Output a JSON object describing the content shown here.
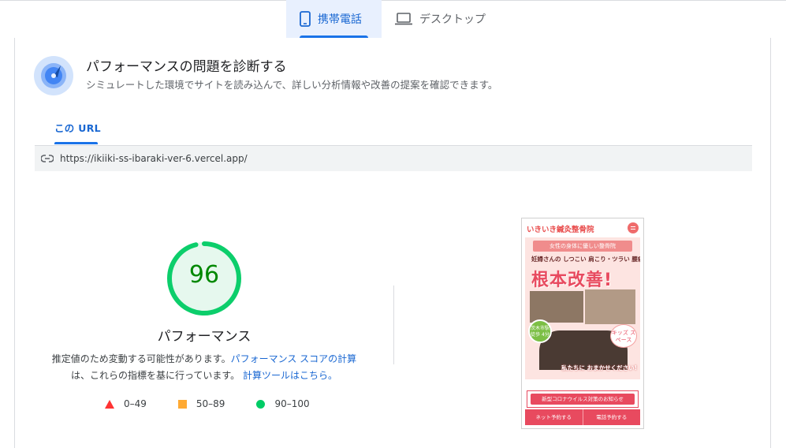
{
  "device_tabs": [
    {
      "label": "携帯電話",
      "icon": "smartphone-icon",
      "active": true
    },
    {
      "label": "デスクトップ",
      "icon": "laptop-icon",
      "active": false
    }
  ],
  "diagnose": {
    "title": "パフォーマンスの問題を診断する",
    "subtitle": "シミュレートした環境でサイトを読み込んで、詳しい分析情報や改善の提案を確認できます。",
    "icon": "gauge-dial-icon"
  },
  "url_tab": {
    "label": "この URL"
  },
  "url_bar": {
    "icon": "link-icon",
    "url": "https://ikiiki-ss-ibaraki-ver-6.vercel.app/"
  },
  "score": {
    "value": "96",
    "fraction": 0.96,
    "label": "パフォーマンス",
    "color": "#0cce6b"
  },
  "description": {
    "part1": "推定値のため変動する可能性があります。",
    "link1": "パフォーマンス スコアの計算",
    "part2": "は、これらの指標を基に行っています。",
    "link2": "計算ツールはこちら。"
  },
  "legend": [
    {
      "shape": "triangle",
      "range": "0–49",
      "color": "#ff3333"
    },
    {
      "shape": "square",
      "range": "50–89",
      "color": "#ffaa33"
    },
    {
      "shape": "circle",
      "range": "90–100",
      "color": "#00cc66"
    }
  ],
  "phone_preview": {
    "brand": "いきいき鍼灸整骨院",
    "ribbon": "女性の身体に優しい整骨院",
    "copy1": "妊婦さんの しつこい 肩こり・ツラい 腰痛",
    "copy2": "根本改善!",
    "badge": "茨木市駅 徒歩 4分",
    "kids": "キッズ スペース",
    "tagline": "私たちに おまかせください!",
    "news": "新型コロナウイルス対策のお知らせ",
    "foot_left": "ネット予約する",
    "foot_right": "電話予約する"
  }
}
